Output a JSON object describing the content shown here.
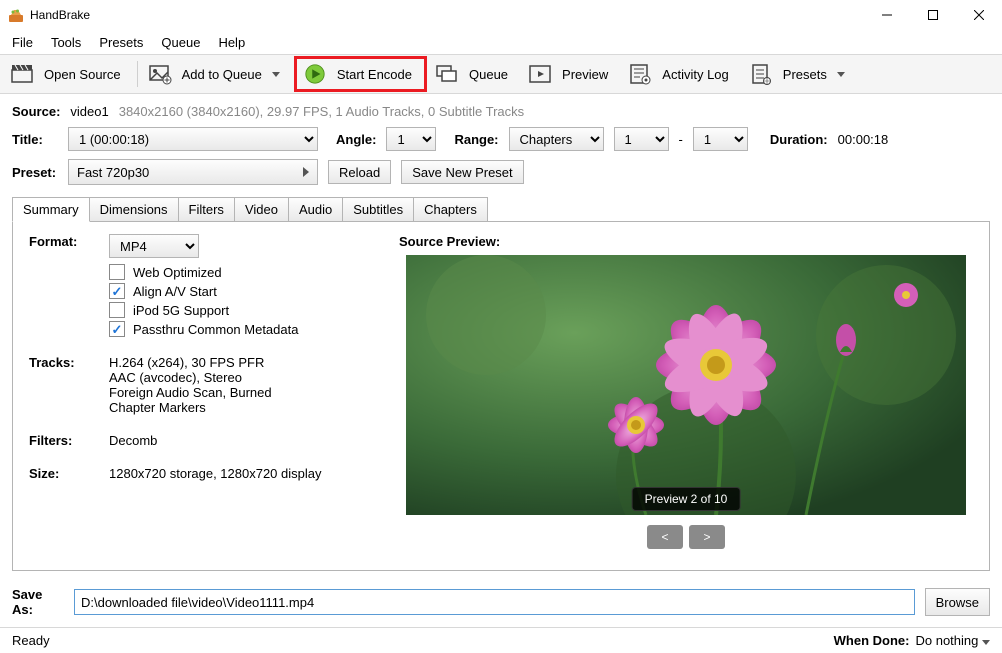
{
  "app": {
    "title": "HandBrake"
  },
  "menubar": {
    "items": [
      "File",
      "Tools",
      "Presets",
      "Queue",
      "Help"
    ]
  },
  "toolbar": {
    "open_source": "Open Source",
    "add_to_queue": "Add to Queue",
    "start_encode": "Start Encode",
    "queue": "Queue",
    "preview": "Preview",
    "activity_log": "Activity Log",
    "presets": "Presets"
  },
  "source": {
    "label": "Source:",
    "name": "video1",
    "details": "3840x2160 (3840x2160), 29.97 FPS, 1 Audio Tracks, 0 Subtitle Tracks"
  },
  "title_row": {
    "label": "Title:",
    "title_value": "1  (00:00:18)",
    "angle_label": "Angle:",
    "angle_value": "1",
    "range_label": "Range:",
    "range_type": "Chapters",
    "range_from": "1",
    "range_sep": "-",
    "range_to": "1",
    "duration_label": "Duration:",
    "duration_value": "00:00:18"
  },
  "preset_row": {
    "label": "Preset:",
    "value": "Fast 720p30",
    "reload": "Reload",
    "save_new": "Save New Preset"
  },
  "tabs": [
    "Summary",
    "Dimensions",
    "Filters",
    "Video",
    "Audio",
    "Subtitles",
    "Chapters"
  ],
  "summary": {
    "format_label": "Format:",
    "format_value": "MP4",
    "cb_web": "Web Optimized",
    "cb_align": "Align A/V Start",
    "cb_ipod": "iPod 5G Support",
    "cb_passthru": "Passthru Common Metadata",
    "tracks_label": "Tracks:",
    "tracks_lines": [
      "H.264 (x264), 30 FPS PFR",
      "AAC (avcodec), Stereo",
      "Foreign Audio Scan, Burned",
      "Chapter Markers"
    ],
    "filters_label": "Filters:",
    "filters_value": "Decomb",
    "size_label": "Size:",
    "size_value": "1280x720 storage, 1280x720 display",
    "preview_label": "Source Preview:",
    "preview_badge": "Preview 2 of 10",
    "nav_prev": "<",
    "nav_next": ">"
  },
  "save_as": {
    "label": "Save As:",
    "value": "D:\\downloaded file\\video\\Video1111.mp4",
    "browse": "Browse"
  },
  "status": {
    "left": "Ready",
    "when_done_label": "When Done:",
    "when_done_value": "Do nothing"
  }
}
